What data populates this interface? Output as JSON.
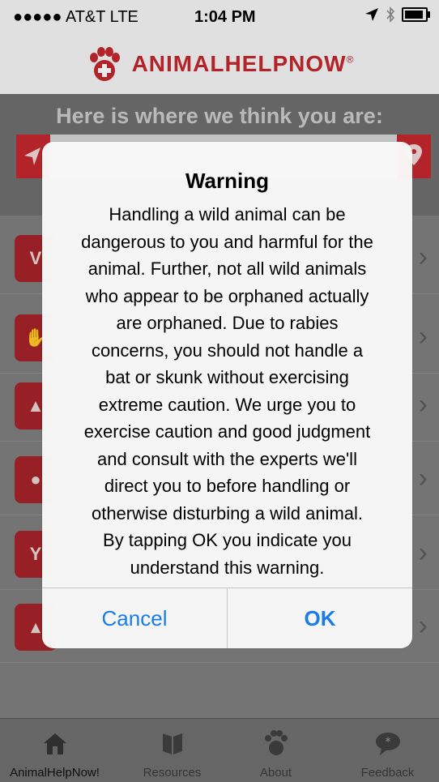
{
  "status_bar": {
    "carrier": "●●●●● AT&T  LTE",
    "time": "1:04 PM"
  },
  "header": {
    "app_name": "ANIMALHELPNOW",
    "trademark": "®"
  },
  "location": {
    "title": "Here is where we think you are:"
  },
  "list": {
    "items": [
      {
        "icon": "vet-icon"
      },
      {
        "icon": "hand-icon"
      },
      {
        "icon": "deer-crossing-icon"
      },
      {
        "icon": "bird-icon"
      },
      {
        "icon": "deer-icon"
      },
      {
        "icon": "fire-icon"
      }
    ]
  },
  "tabs": [
    {
      "label": "AnimalHelpNow!",
      "icon": "home-icon"
    },
    {
      "label": "Resources",
      "icon": "book-icon"
    },
    {
      "label": "About",
      "icon": "paw-icon"
    },
    {
      "label": "Feedback",
      "icon": "speech-bubble-icon"
    }
  ],
  "alert": {
    "title": "Warning",
    "message_lines": [
      "Handling a wild animal can be",
      "dangerous to you and harmful for the",
      "animal. Further, not all wild animals",
      "who appear to be orphaned actually",
      "are orphaned. Due to rabies",
      "concerns, you should not handle a",
      "bat or skunk without exercising",
      "extreme caution. We urge you to",
      "exercise caution and good judgment",
      "and consult with the experts we'll",
      "direct you to before handling or",
      "otherwise disturbing a wild animal.",
      "By tapping OK you indicate you",
      "understand this warning."
    ],
    "cancel_label": "Cancel",
    "ok_label": "OK"
  },
  "colors": {
    "brand_red": "#c2262e",
    "ios_blue": "#1b7ce6"
  }
}
